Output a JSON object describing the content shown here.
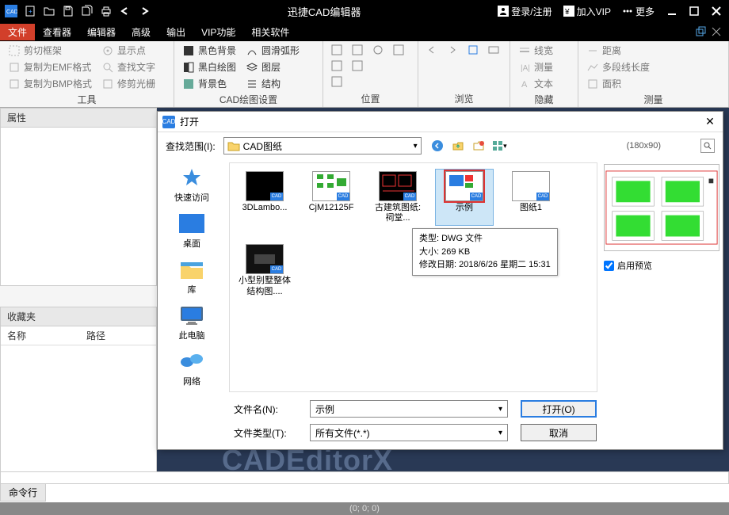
{
  "title": "迅捷CAD编辑器",
  "titlebar_right": {
    "login": "登录/注册",
    "vip": "加入VIP",
    "more": "更多"
  },
  "menubar": [
    "文件",
    "查看器",
    "编辑器",
    "高级",
    "输出",
    "VIP功能",
    "相关软件"
  ],
  "menubar_active": 0,
  "ribbon": {
    "group1": {
      "label": "工具",
      "items": [
        "剪切框架",
        "复制为EMF格式",
        "复制为BMP格式",
        "显示点",
        "查找文字",
        "修剪光栅"
      ]
    },
    "group2": {
      "label": "CAD绘图设置",
      "items": [
        "黑色背景",
        "黑白绘图",
        "背景色",
        "圆滑弧形",
        "图层",
        "结构"
      ]
    },
    "group3": {
      "label": "位置"
    },
    "group4": {
      "label": "浏览"
    },
    "group5": {
      "label": "隐藏",
      "items": [
        "线宽",
        "测量",
        "文本"
      ]
    },
    "group6": {
      "label": "测量",
      "items": [
        "距离",
        "多段线长度",
        "面积"
      ]
    }
  },
  "panels": {
    "properties": "属性",
    "favorites": "收藏夹",
    "fav_cols": [
      "名称",
      "路径"
    ]
  },
  "cmdline_label": "命令行",
  "statusbar_coords": "(0; 0; 0)",
  "watermark": "CADEditorX",
  "dialog": {
    "title": "打开",
    "location_label": "查找范围(I):",
    "location_value": "CAD图纸",
    "preview_dim": "(180x90)",
    "places": [
      "快速访问",
      "桌面",
      "库",
      "此电脑",
      "网络"
    ],
    "files": [
      {
        "name": "3DLambo...",
        "thumb": "black"
      },
      {
        "name": "CjM12125F",
        "thumb": "green"
      },
      {
        "name": "古建筑图纸: 祠堂...",
        "thumb": "redblack"
      },
      {
        "name": "示例",
        "thumb": "mixed",
        "selected": true
      },
      {
        "name": "图纸1",
        "thumb": "white"
      },
      {
        "name": "小型别墅整体结构图....",
        "thumb": "dark"
      }
    ],
    "tooltip": {
      "line1": "类型: DWG 文件",
      "line2": "大小: 269 KB",
      "line3": "修改日期: 2018/6/26 星期二 15:31"
    },
    "enable_preview": "启用预览",
    "filename_label": "文件名(N):",
    "filename_value": "示例",
    "filetype_label": "文件类型(T):",
    "filetype_value": "所有文件(*.*)",
    "open_btn": "打开(O)",
    "cancel_btn": "取消"
  }
}
